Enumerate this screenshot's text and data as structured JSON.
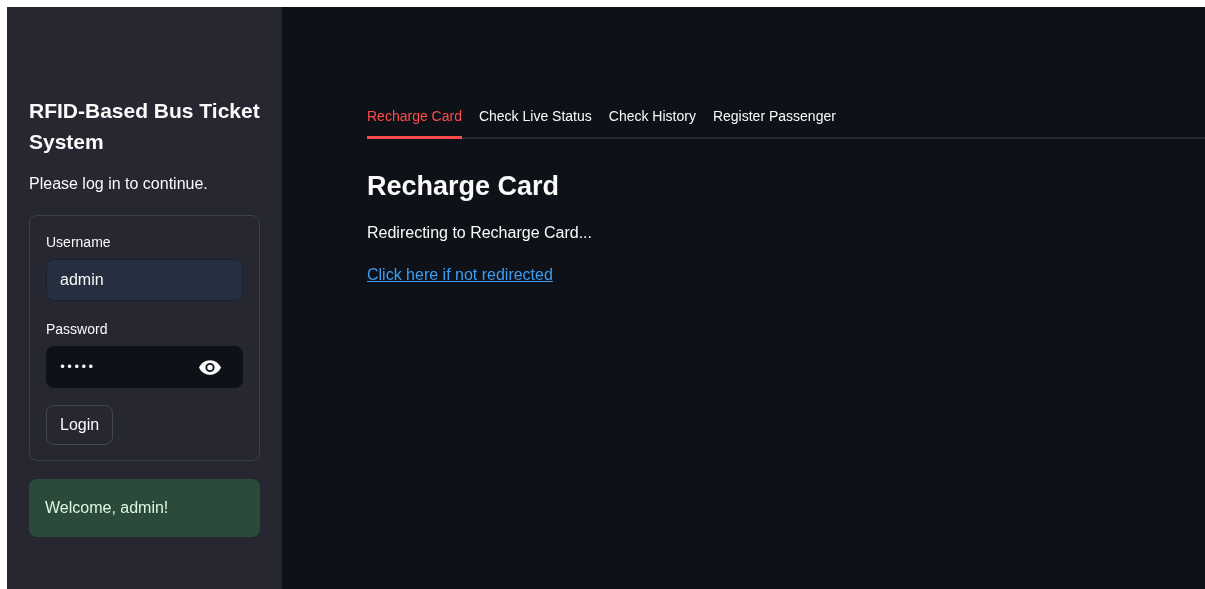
{
  "sidebar": {
    "title": "RFID-Based Bus Ticket System",
    "subtitle": "Please log in to continue.",
    "form": {
      "username": {
        "label": "Username",
        "value": "admin"
      },
      "password": {
        "label": "Password",
        "value": "•••••"
      },
      "button": "Login"
    },
    "success": "Welcome, admin!"
  },
  "tabs": [
    {
      "label": "Recharge Card",
      "selected": true
    },
    {
      "label": "Check Live Status",
      "selected": false
    },
    {
      "label": "Check History",
      "selected": false
    },
    {
      "label": "Register Passenger",
      "selected": false
    }
  ],
  "main": {
    "heading": "Recharge Card",
    "message": "Redirecting to Recharge Card...",
    "link": "Click here if not redirected"
  }
}
